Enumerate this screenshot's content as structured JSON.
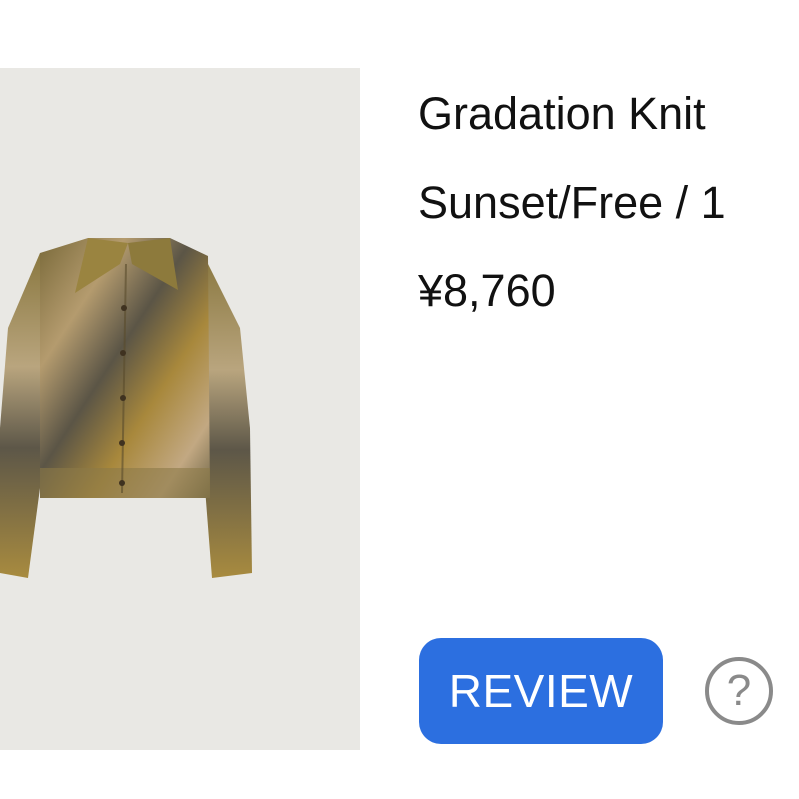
{
  "product": {
    "name": "Gradation Knit",
    "variant": "Sunset/Free / 1",
    "price": "¥8,760",
    "image_icon": "knit-cardigan-photo"
  },
  "actions": {
    "review_label": "REVIEW",
    "review_color": "#2c6fe0",
    "help_icon": "question-circle-icon",
    "help_glyph": "?"
  }
}
